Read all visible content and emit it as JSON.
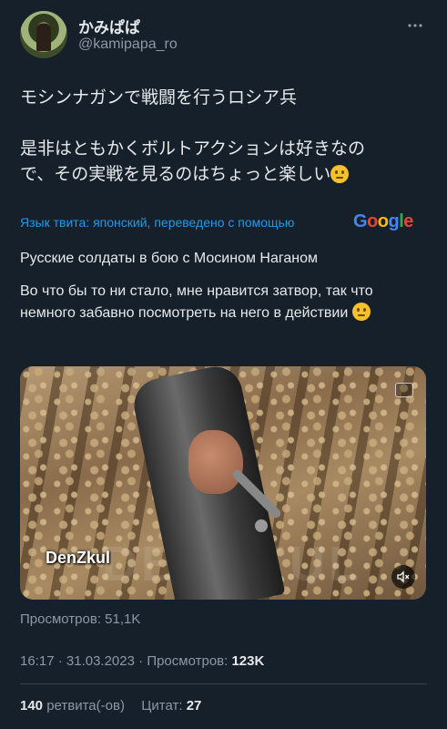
{
  "author": {
    "display_name": "かみぱぱ",
    "handle": "@kamipapa_ro"
  },
  "tweet": {
    "line1": "モシンナガンで戦闘を行うロシア兵",
    "line2": "是非はともかくボルトアクションは好きなの",
    "line3": "で、その実戦を見るのはちょっと楽しい"
  },
  "translation": {
    "label": "Язык твита: японский, переведено с помощью",
    "provider": "Google",
    "para1": "Русские солдаты в бою с Мосином Наганом",
    "para2": "Во что бы то ни стало, мне нравится затвор, так что немного забавно посмотреть на него в действии"
  },
  "media": {
    "watermark": "DenZkul",
    "watermark_big": "DENZKUL"
  },
  "views_small": "Просмотров: 51,1K",
  "meta": {
    "time": "16:17",
    "date": "31.03.2023",
    "views_label": "Просмотров:",
    "views_value": "123K"
  },
  "stats": {
    "retweets_value": "140",
    "retweets_label": "ретвита(-ов)",
    "quotes_label": "Цитат:",
    "quotes_value": "27"
  },
  "icons": {
    "more": "more-horizontal-icon",
    "mute": "volume-muted-icon",
    "emoji": "thinking-face-emoji"
  },
  "colors": {
    "background": "#15202b",
    "accent": "#1d9bf0",
    "secondary_text": "#8b98a5"
  }
}
